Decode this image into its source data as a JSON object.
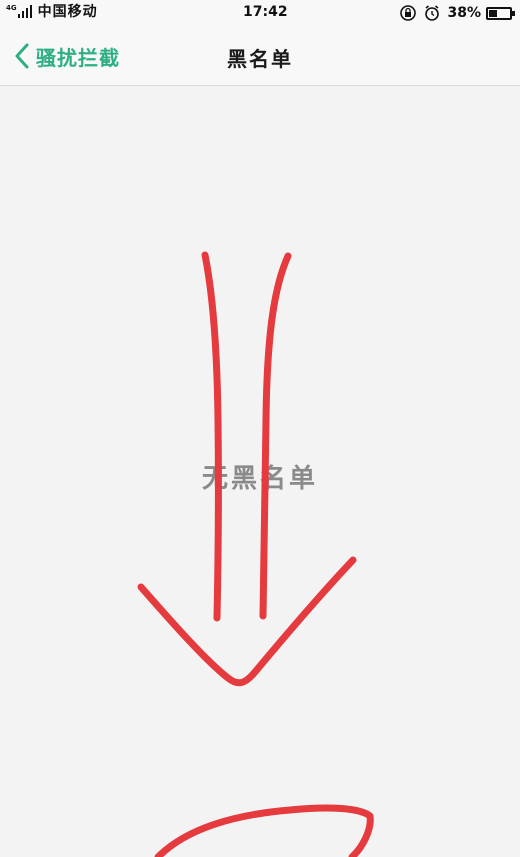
{
  "status_bar": {
    "network_type": "4G",
    "carrier": "中国移动",
    "time": "17:42",
    "battery_percent": "38%",
    "battery_level": 0.38,
    "icons": [
      "signal-icon",
      "lock-rotation-icon",
      "alarm-icon",
      "battery-icon"
    ]
  },
  "nav": {
    "back_label": "骚扰拦截",
    "title": "黑名单",
    "accent_color": "#2eaf82"
  },
  "content": {
    "empty_text": "无黑名单"
  },
  "annotation": {
    "color": "#e53a3e",
    "shapes": [
      "down-arrow",
      "curved-stroke"
    ]
  }
}
